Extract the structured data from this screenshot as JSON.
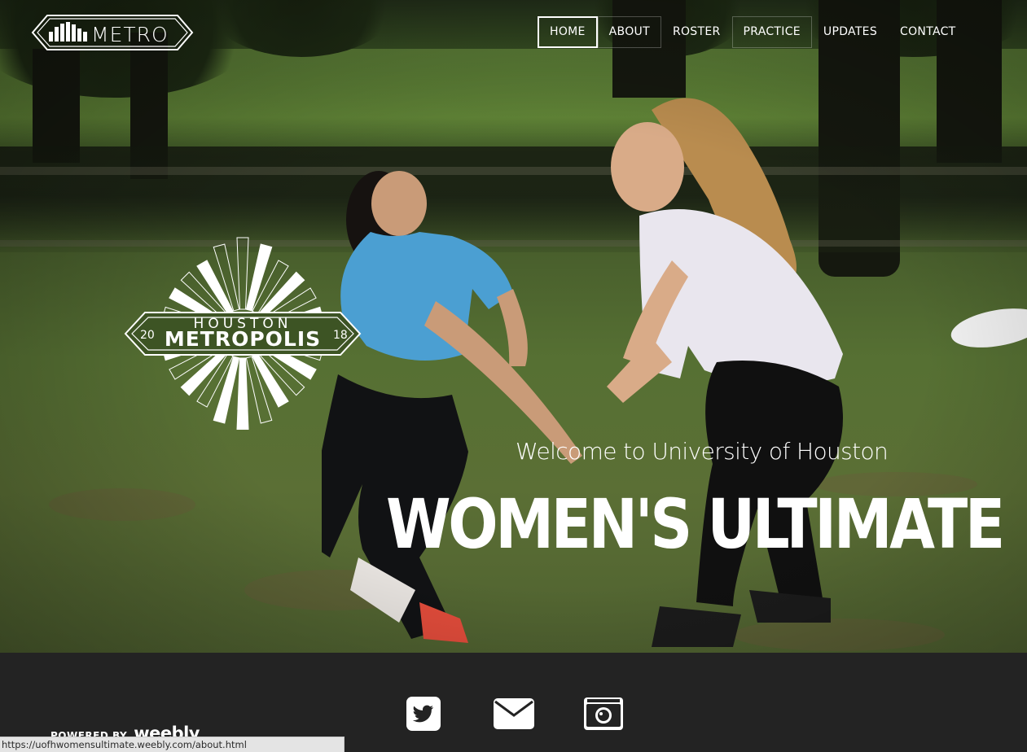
{
  "logo": {
    "text": "METRO"
  },
  "nav": {
    "items": [
      {
        "label": "HOME",
        "state": "active"
      },
      {
        "label": "ABOUT",
        "state": "outlined"
      },
      {
        "label": "ROSTER",
        "state": ""
      },
      {
        "label": "PRACTICE",
        "state": "outlined"
      },
      {
        "label": "UPDATES",
        "state": ""
      },
      {
        "label": "CONTACT",
        "state": ""
      }
    ]
  },
  "emblem": {
    "top_text": "HOUSTON",
    "main_text": "METROPOLIS",
    "year_left": "20",
    "year_right": "18"
  },
  "hero": {
    "welcome": "Welcome to University of Houston",
    "title": "WOMEN'S ULTIMATE"
  },
  "footer": {
    "social_icons": [
      "twitter-icon",
      "envelope-icon",
      "camera-icon"
    ],
    "powered_by": "POWERED BY",
    "brand": "weebly"
  },
  "status_bar": {
    "url": "https://uofhwomensultimate.weebly.com/about.html"
  },
  "colors": {
    "footer_bg": "#232323",
    "text": "#ffffff"
  }
}
